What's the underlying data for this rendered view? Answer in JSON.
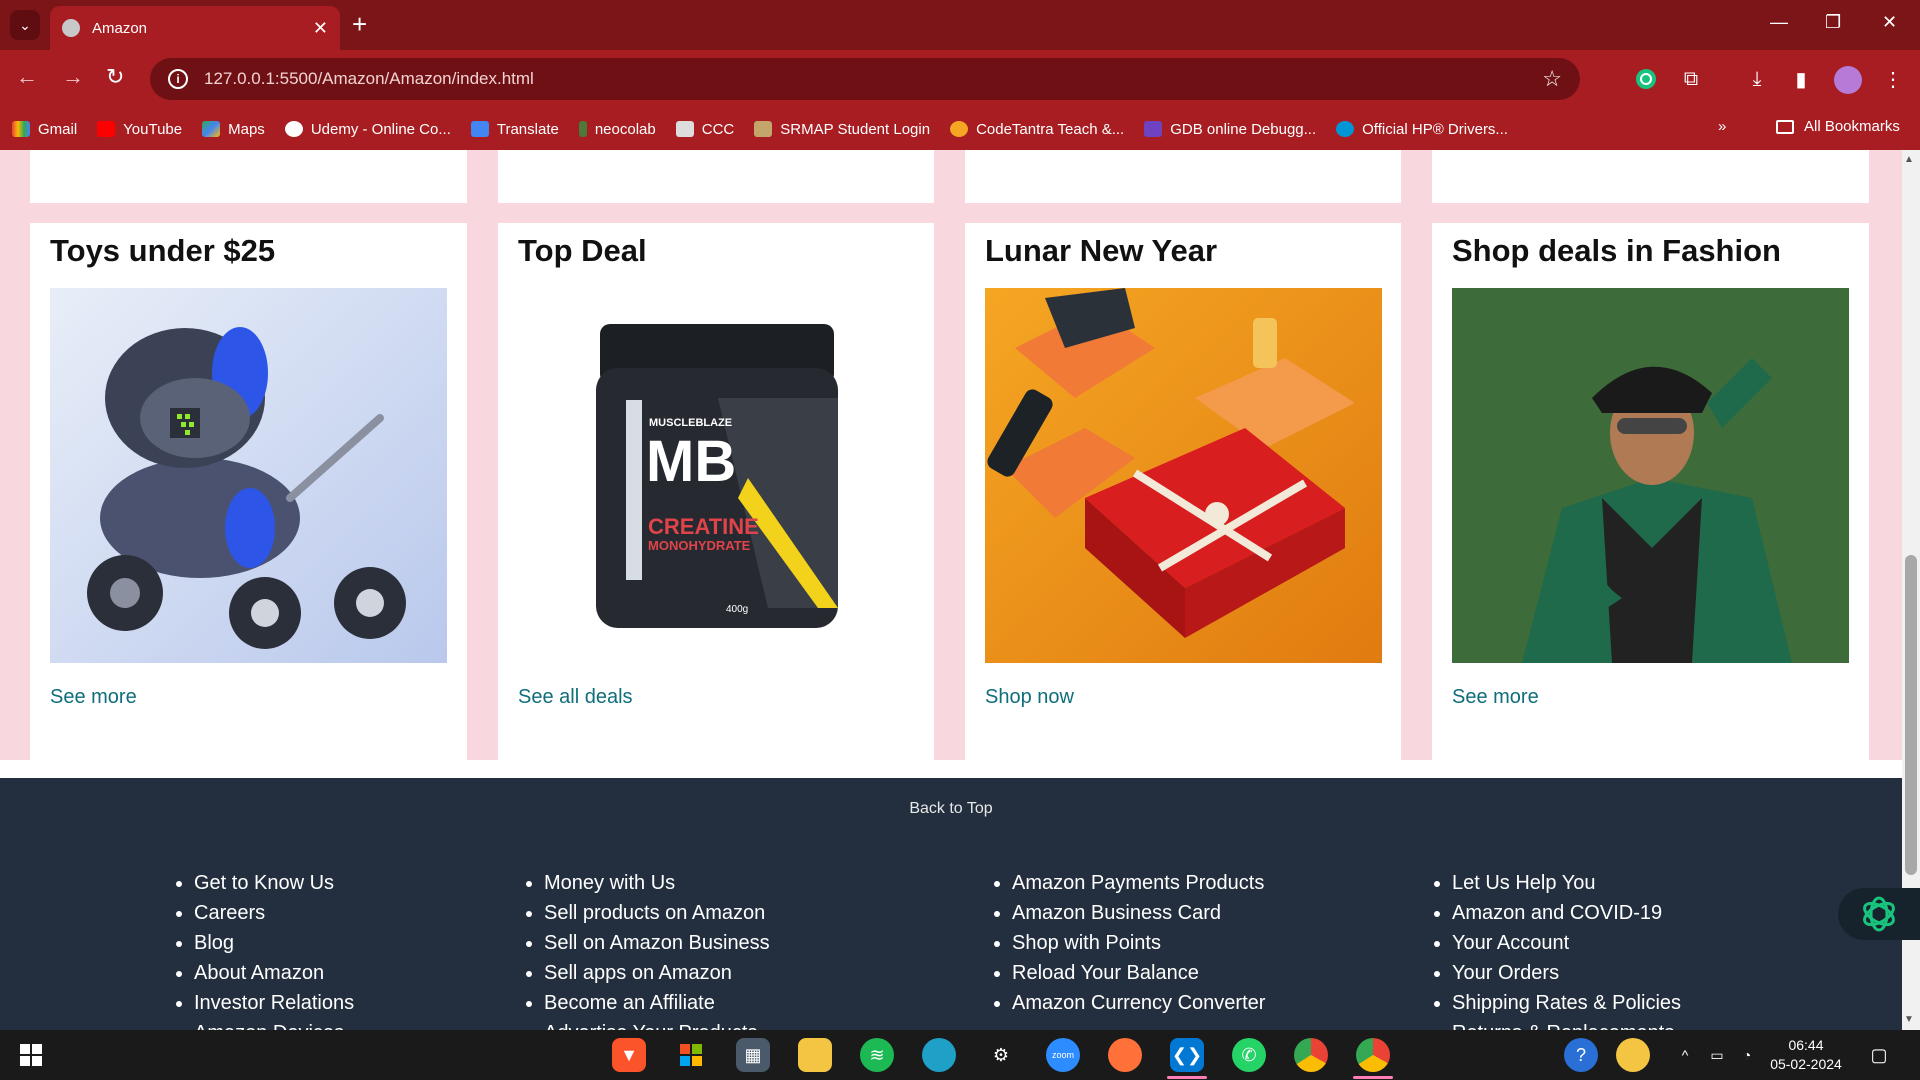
{
  "browser": {
    "tab_title": "Amazon",
    "url": "127.0.0.1:5500/Amazon/Amazon/index.html",
    "bookmarks": [
      "Gmail",
      "YouTube",
      "Maps",
      "Udemy - Online Co...",
      "Translate",
      "neocolab",
      "CCC",
      "SRMAP Student Login",
      "CodeTantra Teach &...",
      "GDB online Debugg...",
      "Official HP® Drivers..."
    ],
    "all_bookmarks": "All Bookmarks"
  },
  "cards": [
    {
      "title": "Toys under $25",
      "link": "See more"
    },
    {
      "title": "Top Deal",
      "link": "See all deals"
    },
    {
      "title": "Lunar New Year",
      "link": "Shop now"
    },
    {
      "title": "Shop deals in Fashion",
      "link": "See more"
    }
  ],
  "product_label": {
    "brand": "MUSCLEBLAZE",
    "logo": "MB",
    "name_line1": "CREATINE",
    "name_line2": "MONOHYDRATE",
    "weight": "400g"
  },
  "footer": {
    "back_to_top": "Back to Top",
    "col1": [
      "Get to Know Us",
      "Careers",
      "Blog",
      "About Amazon",
      "Investor Relations",
      "Amazon Devices"
    ],
    "col2": [
      "Money with Us",
      "Sell products on Amazon",
      "Sell on Amazon Business",
      "Sell apps on Amazon",
      "Become an Affiliate",
      "Advertise Your Products"
    ],
    "col3": [
      "Amazon Payments Products",
      "Amazon Business Card",
      "Shop with Points",
      "Reload Your Balance",
      "Amazon Currency Converter"
    ],
    "col4": [
      "Let Us Help You",
      "Amazon and COVID-19",
      "Your Account",
      "Your Orders",
      "Shipping Rates & Policies",
      "Returns & Replacements"
    ]
  },
  "taskbar": {
    "time": "06:44",
    "date": "05-02-2024",
    "zoom_label": "zoom"
  },
  "colors": {
    "chrome_tabbar": "#7b1518",
    "chrome_toolbar": "#a71d22",
    "page_pink": "#f8d7de",
    "link": "#0f6e7a",
    "footer": "#232f3e"
  }
}
